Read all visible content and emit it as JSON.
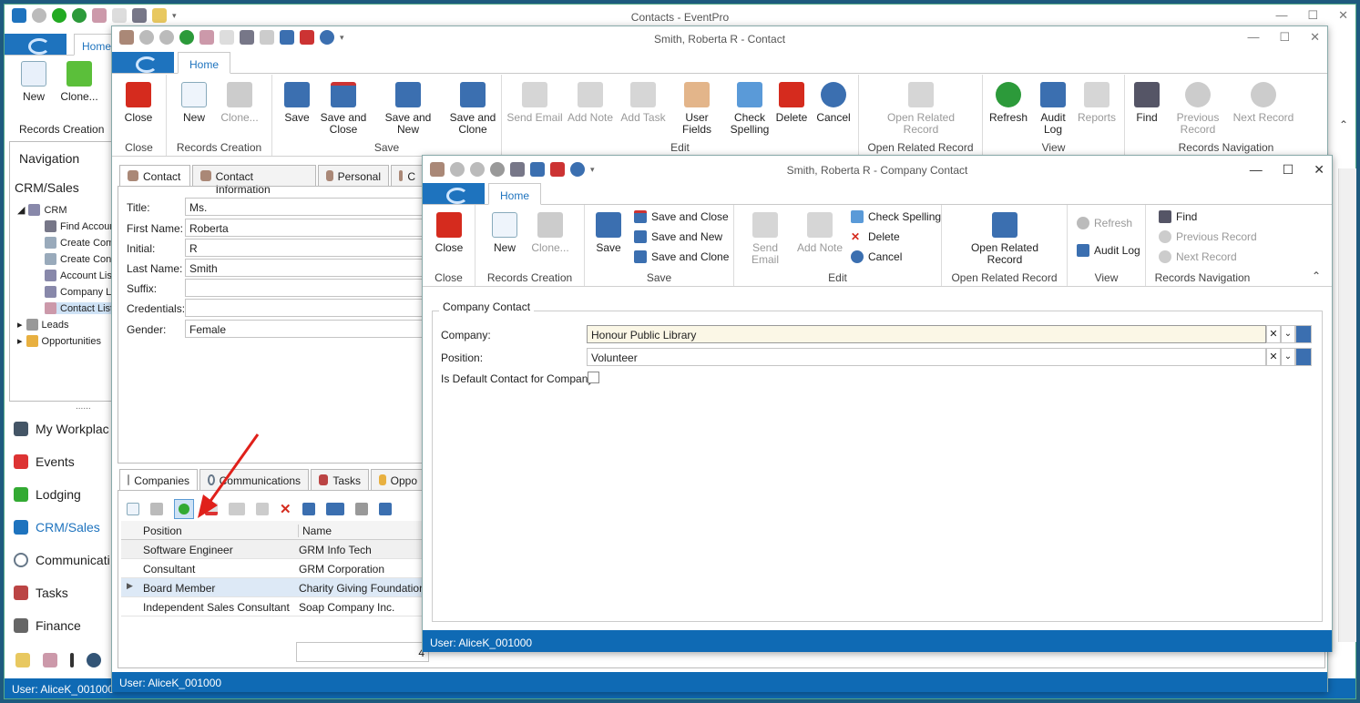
{
  "main_window": {
    "title": "Contacts - EventPro",
    "tab": "Home",
    "records_group": "Records Creation",
    "new_label": "New",
    "clone_label": "Clone...",
    "nav_title": "Navigation",
    "crm_title": "CRM/Sales",
    "tree": [
      "CRM",
      "Find Accoun",
      "Create Com",
      "Create Con",
      "Account Lis",
      "Company Li",
      "Contact List",
      "Leads",
      "Opportunities"
    ],
    "nav_items": [
      "My Workplac",
      "Events",
      "Lodging",
      "CRM/Sales",
      "Communicati",
      "Tasks",
      "Finance"
    ],
    "dots": "......",
    "user": "User: AliceK_001000"
  },
  "contact_window": {
    "title": "Smith, Roberta R - Contact",
    "tab": "Home",
    "ribbon": {
      "close": {
        "label": "Close",
        "group": "Close"
      },
      "records": {
        "group": "Records Creation",
        "new": "New",
        "clone": "Clone..."
      },
      "save": {
        "group": "Save",
        "save": "Save",
        "save_close": "Save and Close",
        "save_new": "Save and New",
        "save_clone": "Save and Clone"
      },
      "edit": {
        "group": "Edit",
        "send_email": "Send Email",
        "add_note": "Add Note",
        "add_task": "Add Task",
        "user_fields": "User Fields",
        "check_spelling": "Check Spelling",
        "delete": "Delete",
        "cancel": "Cancel"
      },
      "open": {
        "group": "Open Related Record",
        "label": "Open Related Record"
      },
      "view": {
        "group": "View",
        "refresh": "Refresh",
        "audit_log": "Audit Log",
        "reports": "Reports"
      },
      "nav": {
        "group": "Records Navigation",
        "find": "Find",
        "previous": "Previous Record",
        "next": "Next Record"
      }
    },
    "tabs": [
      "Contact",
      "Contact Information",
      "Personal",
      "C"
    ],
    "fields": [
      {
        "label": "Title:",
        "value": "Ms."
      },
      {
        "label": "First Name:",
        "value": "Roberta"
      },
      {
        "label": "Initial:",
        "value": "R"
      },
      {
        "label": "Last Name:",
        "value": "Smith"
      },
      {
        "label": "Suffix:",
        "value": ""
      },
      {
        "label": "Credentials:",
        "value": ""
      },
      {
        "label": "Gender:",
        "value": "Female"
      }
    ],
    "bottom_tabs": [
      "Companies",
      "Communications",
      "Tasks",
      "Oppo"
    ],
    "grid": {
      "headers": [
        "Position",
        "Name"
      ],
      "rows": [
        {
          "position": "Software Engineer",
          "name": "GRM Info Tech"
        },
        {
          "position": "Consultant",
          "name": "GRM Corporation"
        },
        {
          "position": "Board Member",
          "name": "Charity Giving Foundation"
        },
        {
          "position": "Independent Sales Consultant",
          "name": "Soap Company Inc."
        }
      ],
      "count": "4"
    },
    "user": "User: AliceK_001000"
  },
  "company_contact_window": {
    "title": "Smith, Roberta R - Company Contact",
    "tab": "Home",
    "ribbon": {
      "close": {
        "label": "Close",
        "group": "Close"
      },
      "records": {
        "group": "Records Creation",
        "new": "New",
        "clone": "Clone..."
      },
      "save": {
        "group": "Save",
        "save": "Save",
        "save_close": "Save and Close",
        "save_new": "Save and New",
        "save_clone": "Save and Clone"
      },
      "edit": {
        "group": "Edit",
        "send_email": "Send Email",
        "add_note": "Add Note",
        "check_spelling": "Check Spelling",
        "delete": "Delete",
        "cancel": "Cancel"
      },
      "open": {
        "group": "Open Related Record",
        "label": "Open Related Record"
      },
      "view": {
        "group": "View",
        "refresh": "Refresh",
        "audit_log": "Audit Log"
      },
      "nav": {
        "group": "Records Navigation",
        "find": "Find",
        "previous": "Previous Record",
        "next": "Next Record"
      }
    },
    "section": "Company Contact",
    "company_label": "Company:",
    "company_value": "Honour Public Library",
    "position_label": "Position:",
    "position_value": "Volunteer",
    "default_label": "Is Default Contact for Company",
    "user": "User: AliceK_001000"
  },
  "colors": {
    "accent": "#1e73be",
    "status": "#0f6ab4",
    "arrow": "#e0201a"
  }
}
